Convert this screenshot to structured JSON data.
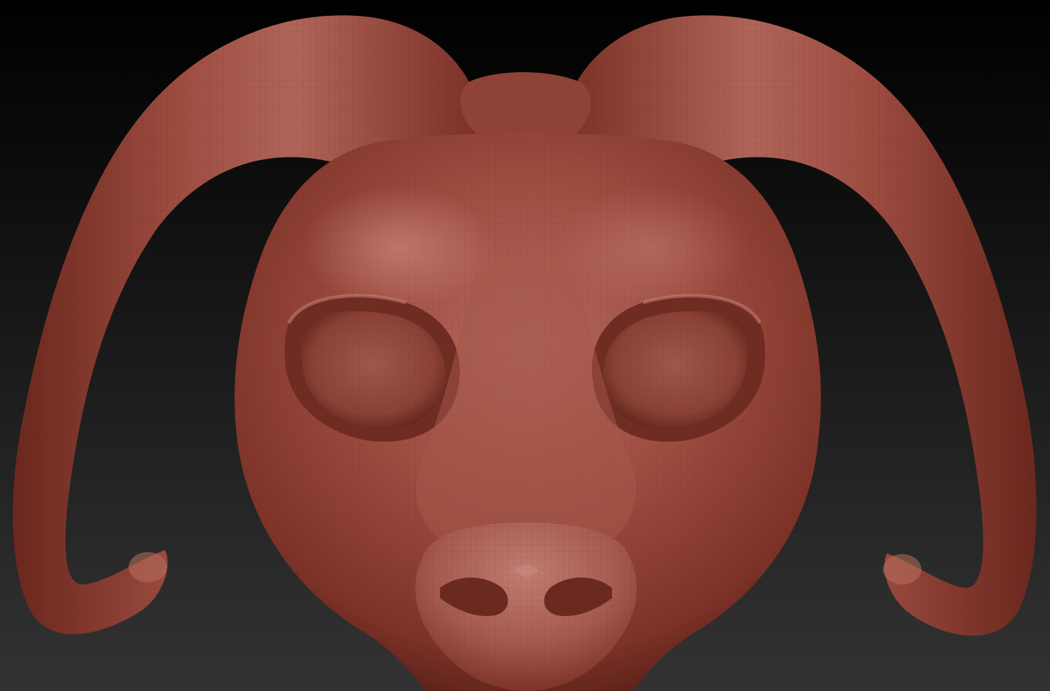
{
  "viewport": {
    "background_top": "#000000",
    "background_bottom": "#333333"
  },
  "model": {
    "subject": "ram-head-mask",
    "material_color": "#9a4a3e",
    "material_highlight": "#c07a6e",
    "material_shadow": "#5a2219",
    "wireframe_visible": true,
    "polyframe_color": "#7a2e24"
  }
}
